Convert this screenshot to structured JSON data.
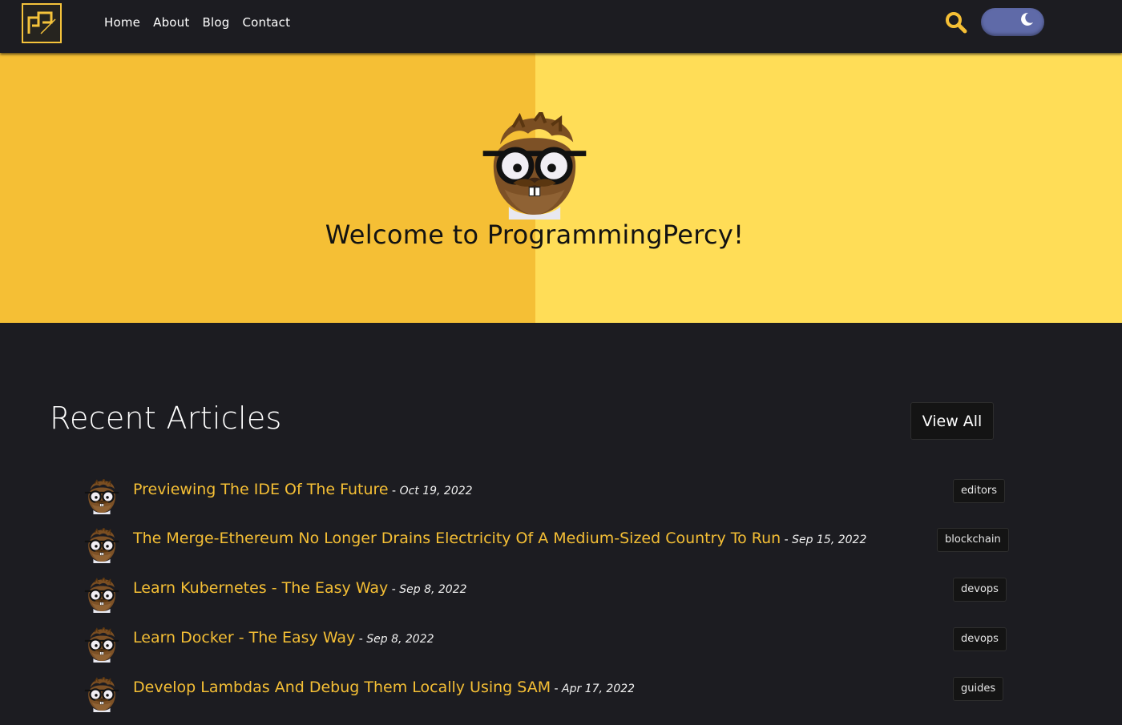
{
  "nav": {
    "links": [
      {
        "label": "Home"
      },
      {
        "label": "About"
      },
      {
        "label": "Blog"
      },
      {
        "label": "Contact"
      }
    ],
    "search_icon": "search-icon",
    "theme_toggle_icon": "moon-icon"
  },
  "hero": {
    "title": "Welcome to ProgrammingPercy!",
    "left_color": "#f5bf35",
    "right_color": "#ffdd57"
  },
  "recent": {
    "title": "Recent Articles",
    "view_all": "View All",
    "articles": [
      {
        "title": "Previewing The IDE Of The Future",
        "sep": " - ",
        "date": "Oct 19, 2022",
        "tag": "editors"
      },
      {
        "title": "The Merge-Ethereum No Longer Drains Electricity Of A Medium-Sized Country To Run",
        "sep": " - ",
        "date": "Sep 15, 2022",
        "tag": "blockchain"
      },
      {
        "title": "Learn Kubernetes - The Easy Way",
        "sep": " - ",
        "date": "Sep 8, 2022",
        "tag": "devops"
      },
      {
        "title": "Learn Docker - The Easy Way",
        "sep": " - ",
        "date": "Sep 8, 2022",
        "tag": "devops"
      },
      {
        "title": "Develop Lambdas And Debug Them Locally Using SAM",
        "sep": " - ",
        "date": "Apr 17, 2022",
        "tag": "guides"
      }
    ]
  },
  "colors": {
    "accent": "#f5bf35",
    "background": "#1c1c21",
    "toggle": "#5f6aa8"
  }
}
